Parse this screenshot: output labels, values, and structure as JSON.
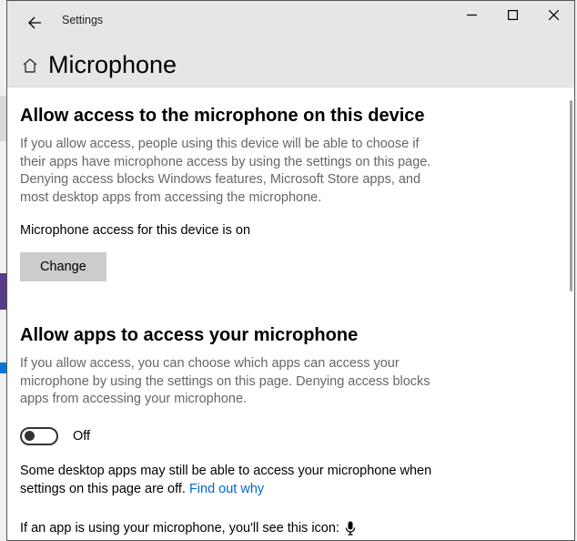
{
  "titlebar": {
    "app_title": "Settings"
  },
  "page": {
    "heading": "Microphone"
  },
  "section_device": {
    "title": "Allow access to the microphone on this device",
    "desc": "If you allow access, people using this device will be able to choose if their apps have microphone access by using the settings on this page. Denying access blocks Windows features, Microsoft Store apps, and most desktop apps from accessing the microphone.",
    "status": "Microphone access for this device is on",
    "change_label": "Change"
  },
  "section_apps": {
    "title": "Allow apps to access your microphone",
    "desc": "If you allow access, you can choose which apps can access your microphone by using the settings on this page. Denying access blocks apps from accessing your microphone.",
    "toggle_state": "Off",
    "note_prefix": "Some desktop apps may still be able to access your microphone when settings on this page are off. ",
    "link_text": "Find out why",
    "usage_text": "If an app is using your microphone, you'll see this icon:"
  }
}
